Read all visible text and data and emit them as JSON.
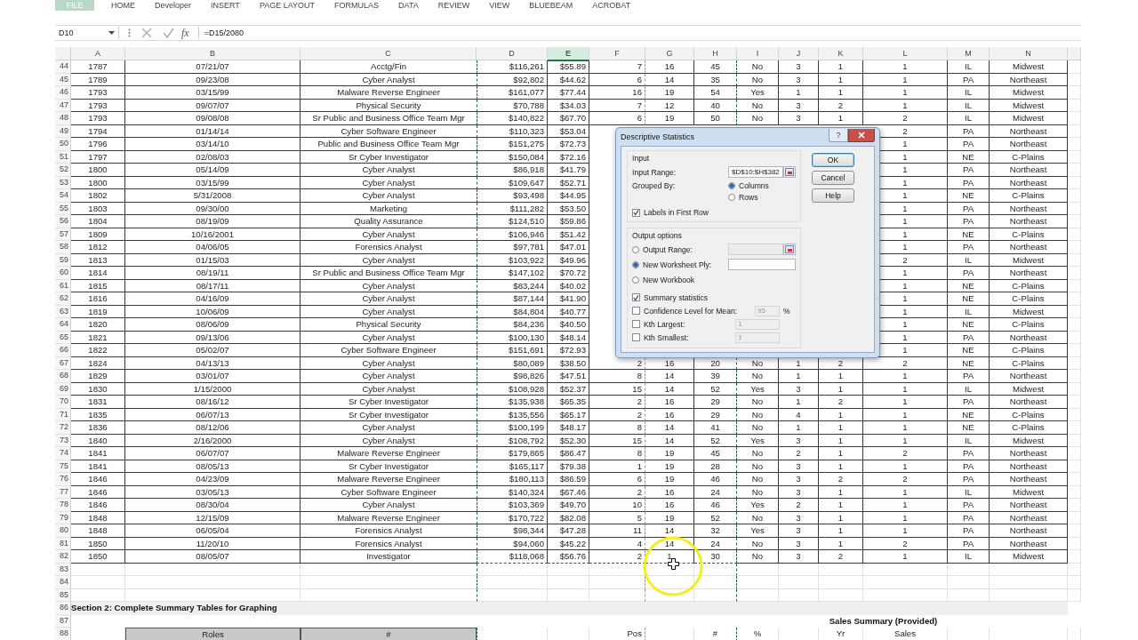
{
  "ribbon": {
    "tabs": [
      {
        "label": "FILE",
        "kind": "file",
        "selected": false
      },
      {
        "label": "HOME",
        "kind": "tab",
        "selected": false
      },
      {
        "label": "Developer",
        "kind": "tab",
        "selected": false
      },
      {
        "label": "INSERT",
        "kind": "tab",
        "selected": false
      },
      {
        "label": "PAGE LAYOUT",
        "kind": "tab",
        "selected": false
      },
      {
        "label": "FORMULAS",
        "kind": "tab",
        "selected": false
      },
      {
        "label": "DATA",
        "kind": "tab",
        "selected": false
      },
      {
        "label": "REVIEW",
        "kind": "tab",
        "selected": false
      },
      {
        "label": "VIEW",
        "kind": "tab",
        "selected": false
      },
      {
        "label": "BLUEBEAM",
        "kind": "tab",
        "selected": false
      },
      {
        "label": "ACROBAT",
        "kind": "tab",
        "selected": false
      }
    ]
  },
  "formula_bar": {
    "name_box": "D10",
    "function_label": "fx",
    "formula": "=D15/2080"
  },
  "columns": [
    {
      "label": "A",
      "selected": false,
      "copied": false
    },
    {
      "label": "B",
      "selected": false,
      "copied": false
    },
    {
      "label": "C",
      "selected": false,
      "copied": false
    },
    {
      "label": "D",
      "selected": false,
      "copied": true
    },
    {
      "label": "E",
      "selected": true,
      "copied": true
    },
    {
      "label": "F",
      "selected": false,
      "copied": true
    },
    {
      "label": "G",
      "selected": false,
      "copied": true
    },
    {
      "label": "H",
      "selected": false,
      "copied": true
    },
    {
      "label": "I",
      "selected": false,
      "copied": false
    },
    {
      "label": "J",
      "selected": false,
      "copied": false
    },
    {
      "label": "K",
      "selected": false,
      "copied": false
    },
    {
      "label": "L",
      "selected": false,
      "copied": false
    },
    {
      "label": "M",
      "selected": false,
      "copied": false
    },
    {
      "label": "N",
      "selected": false,
      "copied": false
    }
  ],
  "rows": [
    {
      "kind": "data",
      "number": "44",
      "cells": [
        "1787",
        "07/21/07",
        "Acctg/Fin",
        "$116,261",
        "$55.89",
        "7",
        "16",
        "45",
        "No",
        "3",
        "1",
        "1",
        "IL",
        "Midwest"
      ]
    },
    {
      "kind": "data",
      "number": "45",
      "cells": [
        "1789",
        "09/23/08",
        "Cyber Analyst",
        "$92,802",
        "$44.62",
        "6",
        "14",
        "35",
        "No",
        "3",
        "1",
        "1",
        "PA",
        "Northeast"
      ]
    },
    {
      "kind": "data",
      "number": "46",
      "cells": [
        "1793",
        "03/15/99",
        "Malware Reverse Engineer",
        "$161,077",
        "$77.44",
        "16",
        "19",
        "54",
        "Yes",
        "1",
        "1",
        "1",
        "IL",
        "Midwest"
      ]
    },
    {
      "kind": "data",
      "number": "47",
      "cells": [
        "1793",
        "09/07/07",
        "Physical Security",
        "$70,788",
        "$34.03",
        "7",
        "12",
        "40",
        "No",
        "3",
        "2",
        "1",
        "IL",
        "Midwest"
      ]
    },
    {
      "kind": "data",
      "number": "48",
      "cells": [
        "1793",
        "09/08/08",
        "Sr Public and Business Office Team Mgr",
        "$140,822",
        "$67.70",
        "6",
        "19",
        "50",
        "No",
        "3",
        "1",
        "2",
        "IL",
        "Midwest"
      ]
    },
    {
      "kind": "data",
      "number": "49",
      "cells": [
        "1794",
        "01/14/14",
        "Cyber Software Engineer",
        "$110,323",
        "$53.04",
        null,
        null,
        null,
        null,
        null,
        null,
        "2",
        "PA",
        "Northeast"
      ]
    },
    {
      "kind": "data",
      "number": "50",
      "cells": [
        "1796",
        "03/14/10",
        "Public and Business Office Team Mgr",
        "$151,275",
        "$72.73",
        null,
        null,
        null,
        null,
        null,
        null,
        "1",
        "PA",
        "Northeast"
      ]
    },
    {
      "kind": "data",
      "number": "51",
      "cells": [
        "1797",
        "02/08/03",
        "Sr Cyber Investigator",
        "$150,084",
        "$72.16",
        null,
        null,
        null,
        null,
        null,
        null,
        "1",
        "NE",
        "C-Plains"
      ]
    },
    {
      "kind": "data",
      "number": "52",
      "cells": [
        "1800",
        "05/14/09",
        "Cyber Analyst",
        "$86,918",
        "$41.79",
        null,
        null,
        null,
        null,
        null,
        null,
        "1",
        "PA",
        "Northeast"
      ]
    },
    {
      "kind": "data",
      "number": "53",
      "cells": [
        "1800",
        "03/15/99",
        "Cyber Analyst",
        "$109,647",
        "$52.71",
        null,
        null,
        null,
        null,
        null,
        null,
        "1",
        "PA",
        "Northeast"
      ]
    },
    {
      "kind": "data",
      "number": "54",
      "cells": [
        "1802",
        "5/31/2008",
        "Cyber Analyst",
        "$93,498",
        "$44.95",
        null,
        null,
        null,
        null,
        null,
        null,
        "1",
        "NE",
        "C-Plains"
      ]
    },
    {
      "kind": "data",
      "number": "55",
      "cells": [
        "1803",
        "09/30/00",
        "Marketing",
        "$111,282",
        "$53.50",
        null,
        null,
        null,
        null,
        null,
        null,
        "1",
        "PA",
        "Northeast"
      ]
    },
    {
      "kind": "data",
      "number": "56",
      "cells": [
        "1804",
        "08/19/09",
        "Quality Assurance",
        "$124,510",
        "$59.86",
        null,
        null,
        null,
        null,
        null,
        null,
        "1",
        "PA",
        "Northeast"
      ]
    },
    {
      "kind": "data",
      "number": "57",
      "cells": [
        "1809",
        "10/16/2001",
        "Cyber Analyst",
        "$106,946",
        "$51.42",
        null,
        null,
        null,
        null,
        null,
        null,
        "1",
        "NE",
        "C-Plains"
      ]
    },
    {
      "kind": "data",
      "number": "58",
      "cells": [
        "1812",
        "04/06/05",
        "Forensics Analyst",
        "$97,781",
        "$47.01",
        null,
        null,
        null,
        null,
        null,
        null,
        "1",
        "PA",
        "Northeast"
      ]
    },
    {
      "kind": "data",
      "number": "59",
      "cells": [
        "1813",
        "01/15/03",
        "Cyber Analyst",
        "$103,922",
        "$49.96",
        null,
        null,
        null,
        null,
        null,
        null,
        "2",
        "IL",
        "Midwest"
      ]
    },
    {
      "kind": "data",
      "number": "60",
      "cells": [
        "1814",
        "08/19/11",
        "Sr Public and Business Office Team Mgr",
        "$147,102",
        "$70.72",
        null,
        null,
        null,
        null,
        null,
        null,
        "1",
        "PA",
        "Northeast"
      ]
    },
    {
      "kind": "data",
      "number": "61",
      "cells": [
        "1815",
        "08/17/11",
        "Cyber Analyst",
        "$83,244",
        "$40.02",
        null,
        null,
        null,
        null,
        null,
        null,
        "1",
        "NE",
        "C-Plains"
      ]
    },
    {
      "kind": "data",
      "number": "62",
      "cells": [
        "1816",
        "04/16/09",
        "Cyber Analyst",
        "$87,144",
        "$41.90",
        null,
        null,
        null,
        null,
        null,
        null,
        "1",
        "NE",
        "C-Plains"
      ]
    },
    {
      "kind": "data",
      "number": "63",
      "cells": [
        "1819",
        "10/06/09",
        "Cyber Analyst",
        "$84,804",
        "$40.77",
        null,
        null,
        null,
        null,
        null,
        null,
        "1",
        "IL",
        "Midwest"
      ]
    },
    {
      "kind": "data",
      "number": "64",
      "cells": [
        "1820",
        "08/06/09",
        "Physical Security",
        "$84,236",
        "$40.50",
        null,
        null,
        null,
        null,
        null,
        null,
        "1",
        "NE",
        "C-Plains"
      ]
    },
    {
      "kind": "data",
      "number": "65",
      "cells": [
        "1821",
        "09/13/06",
        "Cyber Analyst",
        "$100,130",
        "$48.14",
        null,
        null,
        null,
        null,
        null,
        null,
        "1",
        "PA",
        "Northeast"
      ]
    },
    {
      "kind": "data",
      "number": "66",
      "cells": [
        "1822",
        "05/02/07",
        "Cyber Software Engineer",
        "$151,691",
        "$72.93",
        null,
        null,
        null,
        null,
        null,
        null,
        "1",
        "NE",
        "C-Plains"
      ]
    },
    {
      "kind": "data",
      "number": "67",
      "cells": [
        "1824",
        "04/13/13",
        "Cyber Analyst",
        "$80,089",
        "$38.50",
        "2",
        "16",
        "20",
        "No",
        "1",
        "2",
        "2",
        "NE",
        "C-Plains"
      ]
    },
    {
      "kind": "data",
      "number": "68",
      "cells": [
        "1829",
        "03/01/07",
        "Cyber Analyst",
        "$98,826",
        "$47.51",
        "8",
        "14",
        "39",
        "No",
        "1",
        "1",
        "1",
        "PA",
        "Northeast"
      ]
    },
    {
      "kind": "data",
      "number": "69",
      "cells": [
        "1830",
        "1/15/2000",
        "Cyber Analyst",
        "$108,928",
        "$52.37",
        "15",
        "14",
        "52",
        "Yes",
        "3",
        "1",
        "1",
        "IL",
        "Midwest"
      ]
    },
    {
      "kind": "data",
      "number": "70",
      "cells": [
        "1831",
        "08/16/12",
        "Sr Cyber Investigator",
        "$135,938",
        "$65.35",
        "2",
        "16",
        "29",
        "No",
        "1",
        "2",
        "1",
        "PA",
        "Northeast"
      ]
    },
    {
      "kind": "data",
      "number": "71",
      "cells": [
        "1835",
        "06/07/13",
        "Sr Cyber Investigator",
        "$135,556",
        "$65.17",
        "2",
        "16",
        "29",
        "No",
        "4",
        "1",
        "1",
        "NE",
        "C-Plains"
      ]
    },
    {
      "kind": "data",
      "number": "72",
      "cells": [
        "1836",
        "08/12/06",
        "Cyber Analyst",
        "$100,199",
        "$48.17",
        "8",
        "14",
        "41",
        "No",
        "1",
        "1",
        "1",
        "NE",
        "C-Plains"
      ]
    },
    {
      "kind": "data",
      "number": "73",
      "cells": [
        "1840",
        "2/16/2000",
        "Cyber Analyst",
        "$108,792",
        "$52.30",
        "15",
        "14",
        "52",
        "Yes",
        "3",
        "1",
        "1",
        "IL",
        "Midwest"
      ]
    },
    {
      "kind": "data",
      "number": "74",
      "cells": [
        "1841",
        "06/07/07",
        "Malware Reverse Engineer",
        "$179,865",
        "$86.47",
        "8",
        "19",
        "45",
        "No",
        "2",
        "1",
        "2",
        "PA",
        "Northeast"
      ]
    },
    {
      "kind": "data",
      "number": "75",
      "cells": [
        "1841",
        "08/05/13",
        "Sr Cyber Investigator",
        "$165,117",
        "$79.38",
        "1",
        "19",
        "28",
        "No",
        "3",
        "1",
        "1",
        "PA",
        "Northeast"
      ]
    },
    {
      "kind": "data",
      "number": "76",
      "cells": [
        "1846",
        "04/23/09",
        "Malware Reverse Engineer",
        "$180,113",
        "$86.59",
        "6",
        "19",
        "46",
        "No",
        "3",
        "2",
        "2",
        "PA",
        "Northeast"
      ]
    },
    {
      "kind": "data",
      "number": "77",
      "cells": [
        "1846",
        "03/05/13",
        "Cyber Software Engineer",
        "$140,324",
        "$67.46",
        "2",
        "16",
        "24",
        "No",
        "3",
        "1",
        "1",
        "IL",
        "Midwest"
      ]
    },
    {
      "kind": "data",
      "number": "78",
      "cells": [
        "1846",
        "08/30/04",
        "Cyber Analyst",
        "$103,369",
        "$49.70",
        "10",
        "16",
        "46",
        "Yes",
        "2",
        "1",
        "1",
        "PA",
        "Northeast"
      ]
    },
    {
      "kind": "data",
      "number": "79",
      "cells": [
        "1848",
        "12/15/09",
        "Malware Reverse Engineer",
        "$170,722",
        "$82.08",
        "5",
        "19",
        "52",
        "No",
        "3",
        "1",
        "1",
        "PA",
        "Northeast"
      ]
    },
    {
      "kind": "data",
      "number": "80",
      "cells": [
        "1848",
        "06/05/04",
        "Forensics Analyst",
        "$98,344",
        "$47.28",
        "11",
        "14",
        "32",
        "Yes",
        "3",
        "1",
        "1",
        "PA",
        "Northeast"
      ]
    },
    {
      "kind": "data",
      "number": "81",
      "cells": [
        "1850",
        "11/20/10",
        "Forensics Analyst",
        "$94,060",
        "$45.22",
        "4",
        "14",
        "24",
        "No",
        "3",
        "1",
        "2",
        "PA",
        "Northeast"
      ]
    },
    {
      "kind": "data",
      "number": "82",
      "cells": [
        "1850",
        "08/05/07",
        "Investigator",
        "$118,068",
        "$56.76",
        "2",
        "1",
        "30",
        "No",
        "3",
        "2",
        "1",
        "IL",
        "Midwest"
      ]
    },
    {
      "kind": "blank",
      "number": "83"
    },
    {
      "kind": "blank",
      "number": "84"
    },
    {
      "kind": "blank",
      "number": "85"
    },
    {
      "kind": "section",
      "number": "86",
      "title": "Section 2: Complete Summary Tables for Graphing"
    },
    {
      "kind": "caption",
      "number": "87",
      "title": "Sales Summary (Provided)"
    },
    {
      "kind": "header",
      "number": "88",
      "cells": [
        null,
        "Roles",
        "#",
        null,
        null,
        "Pos",
        null,
        "#",
        "%",
        null,
        "Yr",
        "Sales",
        null,
        null
      ]
    }
  ],
  "dialog": {
    "title": "Descriptive Statistics",
    "help_glyph": "?",
    "input": {
      "heading": "Input",
      "range_label": "Input Range:",
      "range_value": "$D$10:$H$382",
      "grouped_by_label": "Grouped By:",
      "grouped_by": [
        {
          "label": "Columns",
          "selected": true
        },
        {
          "label": "Rows",
          "selected": false
        }
      ],
      "labels_first_row": {
        "label": "Labels in First Row",
        "checked": true
      }
    },
    "output": {
      "heading": "Output options",
      "destinations": [
        {
          "label": "Output Range:",
          "selected": false,
          "field": {
            "disabled": true,
            "picker": true
          }
        },
        {
          "label": "New Worksheet Ply:",
          "selected": true,
          "field": {
            "disabled": false,
            "picker": false
          }
        },
        {
          "label": "New Workbook",
          "selected": false
        }
      ],
      "statistics": [
        {
          "label": "Summary statistics",
          "checked": true
        },
        {
          "label": "Confidence Level for Mean:",
          "checked": false,
          "field": {
            "value": "95",
            "disabled": true,
            "suffix": "%"
          }
        },
        {
          "label": "Kth Largest:",
          "checked": false,
          "field": {
            "value": "1",
            "disabled": true
          }
        },
        {
          "label": "Kth Smallest:",
          "checked": false,
          "field": {
            "value": "1",
            "disabled": true
          }
        }
      ]
    },
    "buttons": [
      {
        "label": "OK",
        "default": true
      },
      {
        "label": "Cancel",
        "default": false
      },
      {
        "label": "Help",
        "default": false
      }
    ]
  }
}
